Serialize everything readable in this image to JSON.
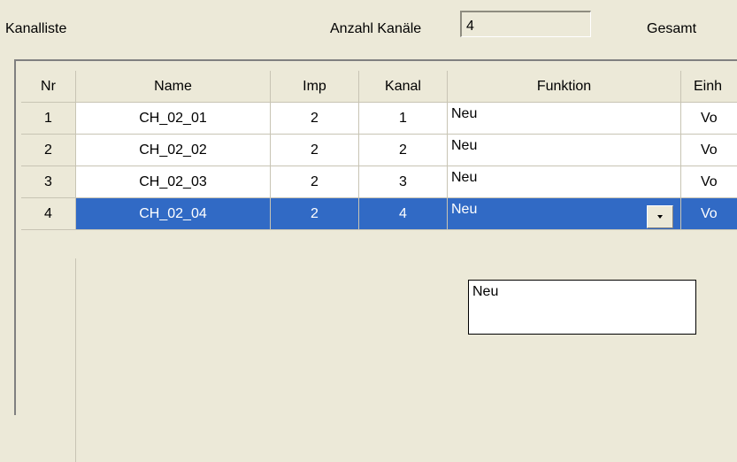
{
  "header": {
    "title": "Kanalliste",
    "count_label": "Anzahl Kanäle",
    "count_value": "4",
    "total_label": "Gesamt"
  },
  "table": {
    "columns": [
      "Nr",
      "Name",
      "Imp",
      "Kanal",
      "Funktion",
      "Einh"
    ],
    "rows": [
      {
        "nr": "1",
        "name": "CH_02_01",
        "imp": "2",
        "kanal": "1",
        "funktion": "Neu",
        "einheit": "Vo"
      },
      {
        "nr": "2",
        "name": "CH_02_02",
        "imp": "2",
        "kanal": "2",
        "funktion": "Neu",
        "einheit": "Vo"
      },
      {
        "nr": "3",
        "name": "CH_02_03",
        "imp": "2",
        "kanal": "3",
        "funktion": "Neu",
        "einheit": "Vo"
      },
      {
        "nr": "4",
        "name": "CH_02_04",
        "imp": "2",
        "kanal": "4",
        "funktion": "Neu",
        "einheit": "Vo"
      }
    ],
    "selected_row": "4"
  },
  "dropdown": {
    "options": [
      "Neu"
    ]
  },
  "colors": {
    "selection": "#316ac5",
    "window_bg": "#ece9d8"
  }
}
